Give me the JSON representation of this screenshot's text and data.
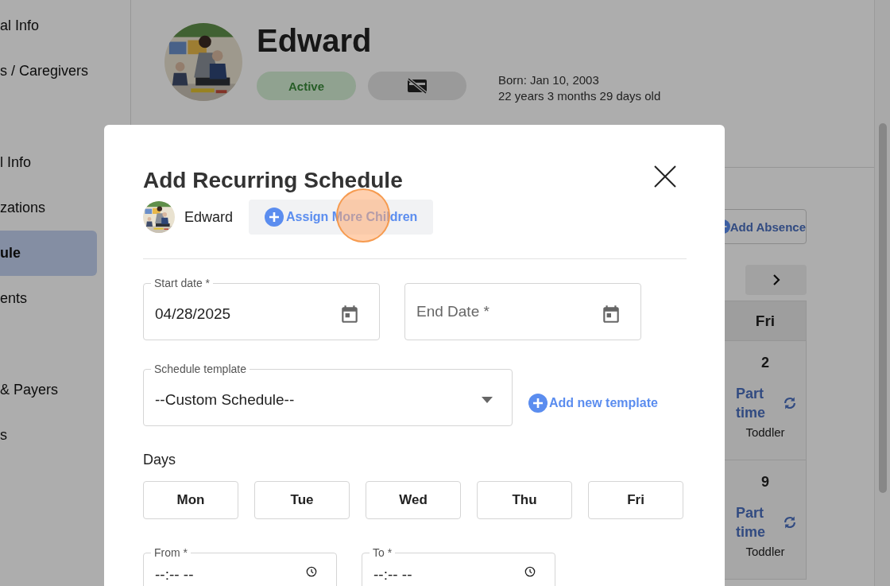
{
  "sidebar": {
    "sections": [
      {
        "items": [
          {
            "label": "al Info",
            "selected": false
          },
          {
            "label": "s / Caregivers",
            "selected": false
          }
        ]
      },
      {
        "items": [
          {
            "label": "l Info",
            "selected": false
          },
          {
            "label": "zations",
            "selected": false
          },
          {
            "label": "ule",
            "selected": true
          },
          {
            "label": "ents",
            "selected": false
          }
        ]
      },
      {
        "items": [
          {
            "label": "& Payers",
            "selected": false
          },
          {
            "label": "s",
            "selected": false
          }
        ]
      }
    ]
  },
  "profile": {
    "name": "Edward",
    "status": "Active",
    "born": "Born: Jan 10, 2003",
    "age": "22 years 3 months 29 days old"
  },
  "calendar": {
    "add_absence": "Add Absence",
    "day_header": "Fri",
    "cells": [
      {
        "date": "2",
        "schedule": "Part time",
        "room": "Toddler"
      },
      {
        "date": "9",
        "schedule": "Part time",
        "room": "Toddler"
      }
    ]
  },
  "modal": {
    "title": "Add Recurring Schedule",
    "child": {
      "name": "Edward"
    },
    "assign_button": "Assign More Children",
    "start_date": {
      "label": "Start date *",
      "value": "04/28/2025"
    },
    "end_date": {
      "placeholder": "End Date *"
    },
    "template": {
      "label": "Schedule template",
      "value": "--Custom Schedule--"
    },
    "add_template": "Add new template",
    "days_label": "Days",
    "days": [
      {
        "label": "Mon",
        "selected": false
      },
      {
        "label": "Tue",
        "selected": false
      },
      {
        "label": "Wed",
        "selected": false
      },
      {
        "label": "Thu",
        "selected": false
      },
      {
        "label": "Fri",
        "selected": false
      }
    ],
    "from": {
      "label": "From *",
      "value": "--:-- --"
    },
    "to": {
      "label": "To *",
      "value": "--:-- --"
    }
  }
}
